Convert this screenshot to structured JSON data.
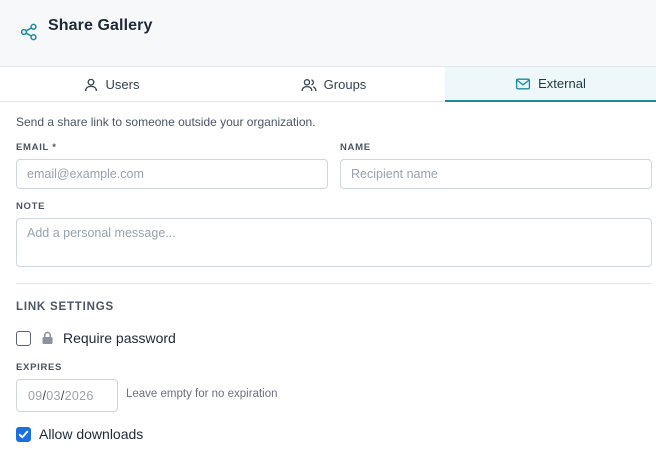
{
  "header": {
    "title": "Share Gallery",
    "icon": "share-icon"
  },
  "tabs": [
    {
      "label": "Users",
      "icon": "user-icon",
      "active": false
    },
    {
      "label": "Groups",
      "icon": "users-icon",
      "active": false
    },
    {
      "label": "External",
      "icon": "mail-icon",
      "active": true
    }
  ],
  "form": {
    "intro": "Send a share link to someone outside your organization.",
    "email_label": "EMAIL *",
    "email_placeholder": "email@example.com",
    "name_label": "NAME",
    "name_placeholder": "Recipient name",
    "note_label": "NOTE",
    "note_placeholder": "Add a personal message..."
  },
  "link_settings": {
    "title": "LINK SETTINGS",
    "require_password": {
      "label": "Require password",
      "checked": false
    },
    "expires_label": "EXPIRES",
    "expires_date": {
      "month": "09",
      "day": "03",
      "year": "2026",
      "separator": "/"
    },
    "expires_hint": "Leave empty for no expiration",
    "allow_downloads": {
      "label": "Allow downloads",
      "checked": true
    }
  },
  "colors": {
    "accent": "#1b8aa3",
    "checkbox": "#1a6fe0",
    "header_bg": "#f6f8fa"
  }
}
